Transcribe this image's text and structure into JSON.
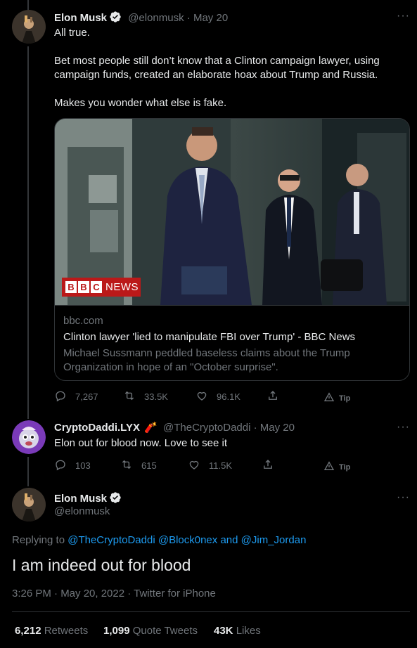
{
  "tweet1": {
    "author_name": "Elon Musk",
    "handle": "@elonmusk",
    "date": "May 20",
    "more": "···",
    "lines": [
      "All true.",
      "Bet most people still don’t know that a Clinton campaign lawyer, using",
      "campaign funds, created an elaborate hoax about Trump and Russia.",
      "Makes you wonder what else is fake."
    ],
    "card": {
      "news_badge_logo": "BBC",
      "news_badge_text": "NEWS",
      "domain": "bbc.com",
      "title": "Clinton lawyer 'lied to manipulate FBI over Trump' - BBC News",
      "description": "Michael Sussmann peddled baseless claims about the Trump Organization in hope of an \"October surprise\"."
    },
    "actions": {
      "replies": "7,267",
      "retweets": "33.5K",
      "likes": "96.1K",
      "tip": "Tip"
    }
  },
  "tweet2": {
    "author_name": "CryptoDaddi.LYX",
    "name_emoji": "🧨",
    "handle": "@TheCryptoDaddi",
    "date": "May 20",
    "more": "···",
    "text": "Elon out for blood now. Love to see it",
    "actions": {
      "replies": "103",
      "retweets": "615",
      "likes": "11.5K",
      "tip": "Tip"
    }
  },
  "main_tweet": {
    "author_name": "Elon Musk",
    "handle": "@elonmusk",
    "more": "···",
    "replying_prefix": "Replying to",
    "reply_to_1": "@TheCryptoDaddi",
    "reply_to_2": "@Block0nex",
    "reply_and": "and",
    "reply_to_3": "@Jim_Jordan",
    "text": "I am indeed out for blood",
    "time": "3:26 PM · May 20, 2022 · Twitter for iPhone",
    "stats": {
      "retweets_count": "6,212",
      "retweets_label": "Retweets",
      "quotes_count": "1,099",
      "quotes_label": "Quote Tweets",
      "likes_count": "43K",
      "likes_label": "Likes"
    }
  },
  "colors": {
    "background": "#000000",
    "text": "#e7e9ea",
    "muted": "#71767b",
    "link": "#1d9bf0",
    "bbc_red": "#bb1919"
  }
}
